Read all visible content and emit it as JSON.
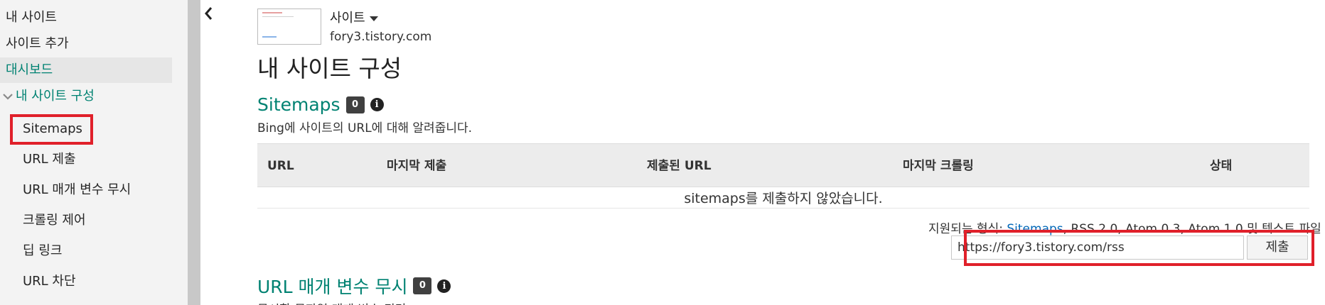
{
  "sidebar": {
    "items": [
      {
        "label": "내 사이트"
      },
      {
        "label": "사이트 추가"
      },
      {
        "label": "대시보드"
      },
      {
        "label": "내 사이트 구성"
      },
      {
        "label": "Sitemaps"
      },
      {
        "label": "URL 제출"
      },
      {
        "label": "URL 매개 변수 무시"
      },
      {
        "label": "크롤링 제어"
      },
      {
        "label": "딥 링크"
      },
      {
        "label": "URL 차단"
      }
    ]
  },
  "header": {
    "site_selector": "사이트",
    "site_url": "fory3.tistory.com",
    "page_title": "내 사이트 구성"
  },
  "sitemaps": {
    "title": "Sitemaps",
    "count": "0",
    "description": "Bing에 사이트의 URL에 대해 알려줍니다.",
    "columns": [
      "URL",
      "마지막 제출",
      "제출된 URL",
      "마지막 크롤링",
      "상태"
    ],
    "empty_message": "sitemaps를 제출하지 않았습니다.",
    "formats_prefix": "지원되는 형식: ",
    "formats_link": "Sitemaps",
    "formats_rest": ", RSS 2.0, Atom 0.3, Atom 1.0 및 텍스트 파일",
    "submit_value": "https://fory3.tistory.com/rss",
    "submit_label": "제출"
  },
  "url_params": {
    "title": "URL 매개 변수 무시",
    "count": "0",
    "description": "무시할 문자열 매개 변수 쿼리"
  },
  "colors": {
    "accent": "#008272",
    "highlight": "#e0202a",
    "link": "#0067b8",
    "badge": "#404040"
  }
}
